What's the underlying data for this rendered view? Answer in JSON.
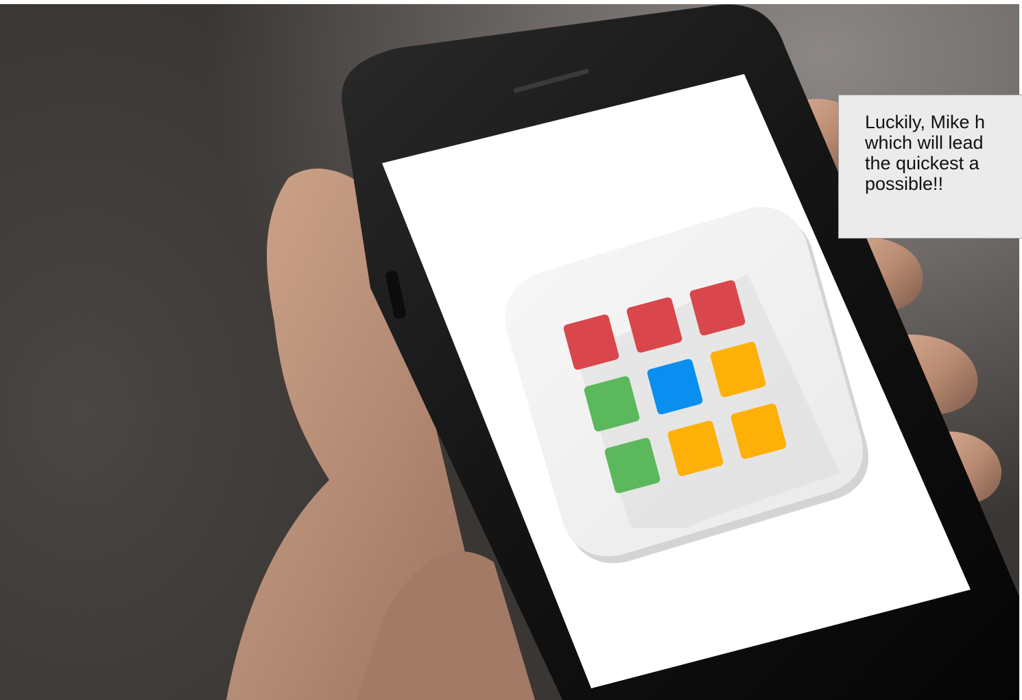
{
  "speech_box": {
    "text": "Luckily, Mike h\nwhich will lead\nthe quickest a\npossible!!"
  },
  "app_icon": {
    "icon": "app-grid-icon",
    "tiles": [
      {
        "color": "#d9474c"
      },
      {
        "color": "#d9474c"
      },
      {
        "color": "#d9474c"
      },
      {
        "color": "#5cb85c"
      },
      {
        "color": "#0a8ef0"
      },
      {
        "color": "#fdb007"
      },
      {
        "color": "#5cb85c"
      },
      {
        "color": "#fdb007"
      },
      {
        "color": "#fdb007"
      }
    ]
  },
  "colors": {
    "phone_body": "#141414",
    "screen": "#ffffff",
    "skin": "#c79a80",
    "icon_bg": "#f3f3f3"
  }
}
